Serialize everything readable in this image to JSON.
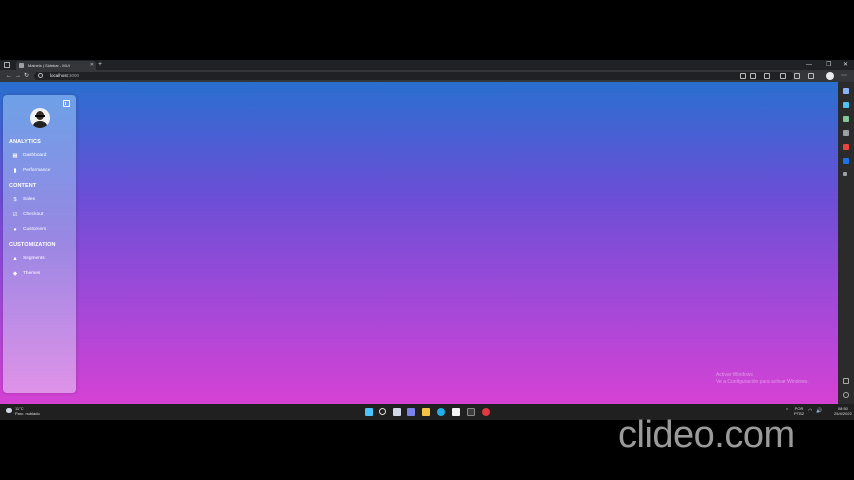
{
  "browser": {
    "tab_title": "Mainels | Sidebar - MUI",
    "new_tab": "+",
    "url_host": "localhost",
    "url_port": ":3000",
    "window_controls": [
      "—",
      "❐",
      "✕"
    ],
    "nav_icons": [
      "back-icon",
      "forward-icon",
      "reload-icon"
    ]
  },
  "sidebar": {
    "sections": [
      {
        "title": "ANALYTICS",
        "items": [
          {
            "label": "Dashboard",
            "icon": "▦"
          },
          {
            "label": "Performance",
            "icon": "▮"
          }
        ]
      },
      {
        "title": "CONTENT",
        "items": [
          {
            "label": "Sales",
            "icon": "$"
          },
          {
            "label": "Checkout",
            "icon": "☑"
          },
          {
            "label": "Customers",
            "icon": "●"
          }
        ]
      },
      {
        "title": "CUSTOMIZATION",
        "items": [
          {
            "label": "Segments",
            "icon": "▲"
          },
          {
            "label": "Themes",
            "icon": "◆"
          }
        ]
      }
    ]
  },
  "watermark": {
    "line1": "Activar Windows",
    "line2": "Ve a Configuración para activar Windows."
  },
  "taskbar": {
    "weather_temp": "11°C",
    "weather_desc": "Parc. nublado",
    "lang1": "POR",
    "lang2": "PTB2",
    "time": "08:50",
    "date": "25/4/2022",
    "volume_icon": "🔊"
  },
  "overlay": {
    "brand": "clideo.com"
  },
  "colors": {
    "gradient_top": "#2a6fd0",
    "gradient_bottom": "#d542d4"
  }
}
